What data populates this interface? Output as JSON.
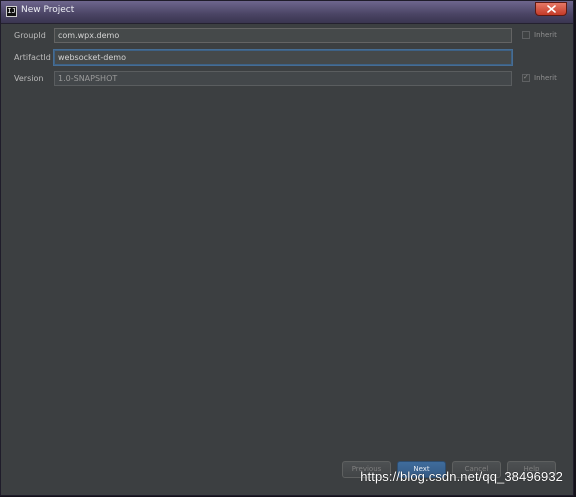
{
  "window": {
    "title": "New Project",
    "app_icon_glyph": "IJ",
    "close_icon": "close-icon"
  },
  "form": {
    "rows": [
      {
        "label": "GroupId",
        "value": "com.wpx.demo",
        "inherit_label": "Inherit",
        "inherit_checked": false
      },
      {
        "label": "ArtifactId",
        "value": "websocket-demo"
      },
      {
        "label": "Version",
        "value": "1.0-SNAPSHOT",
        "inherit_label": "Inherit",
        "inherit_checked": true
      }
    ]
  },
  "buttons": {
    "previous": "Previous",
    "next": "Next",
    "cancel": "Cancel",
    "help": "Help"
  },
  "watermark": "https://blog.csdn.net/qq_38496932",
  "colors": {
    "background": "#3c3f41",
    "accent": "#3d6185",
    "primary_button": "#365d88"
  }
}
